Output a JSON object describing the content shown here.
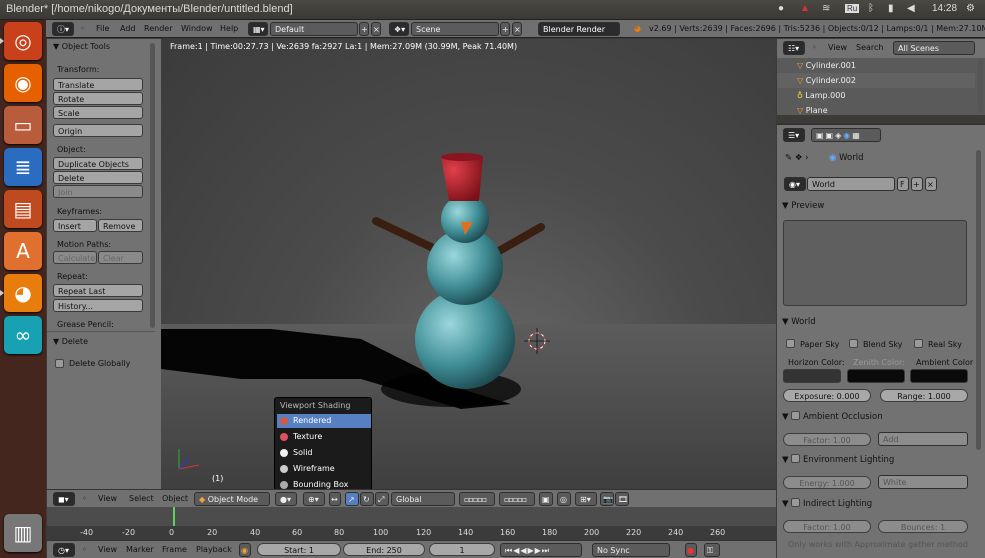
{
  "window": {
    "title": "Blender* [/home/nikogo/Документы/Blender/untitled.blend]"
  },
  "tray": {
    "kbd": "Ru",
    "time": "14:28"
  },
  "launcher": [
    "dash",
    "firefox",
    "files",
    "writer",
    "impress",
    "software",
    "blender",
    "arduino",
    "trash"
  ],
  "header": {
    "menus": [
      "File",
      "Add",
      "Render",
      "Window",
      "Help"
    ],
    "layout": "Default",
    "scene": "Scene",
    "engine": "Blender Render",
    "stats": "v2.69 | Verts:2639 | Faces:2696 | Tris:5236 | Objects:0/12 | Lamps:0/1 | Mem:27.10M (30.9"
  },
  "tools": {
    "panel_title": "Object Tools",
    "transform_label": "Transform:",
    "translate": "Translate",
    "rotate": "Rotate",
    "scale": "Scale",
    "origin": "Origin",
    "object_label": "Object:",
    "duplicate": "Duplicate Objects",
    "delete": "Delete",
    "join": "Join",
    "keyframes_label": "Keyframes:",
    "insert": "Insert",
    "remove": "Remove",
    "motion_label": "Motion Paths:",
    "calculate": "Calculate",
    "clear": "Clear",
    "repeat_label": "Repeat:",
    "repeat_last": "Repeat Last",
    "history": "History...",
    "grease_label": "Grease Pencil:",
    "delete_panel": "Delete",
    "delete_globally": "Delete Globally"
  },
  "viewport": {
    "info": "Frame:1 | Time:00:27.73 | Ve:2639 fa:2927 La:1 | Mem:27.09M (30.99M, Peak 71.40M)",
    "frame_label": "(1)"
  },
  "shading_menu": {
    "title": "Viewport Shading",
    "items": [
      {
        "label": "Rendered",
        "color": "#d05a4a"
      },
      {
        "label": "Texture",
        "color": "#e05060"
      },
      {
        "label": "Solid",
        "color": "#f0f0f0"
      },
      {
        "label": "Wireframe",
        "color": "#cccccc"
      },
      {
        "label": "Bounding Box",
        "color": "#aaaaaa"
      }
    ]
  },
  "vp_header": {
    "view": "View",
    "select": "Select",
    "object": "Object",
    "mode": "Object Mode",
    "orientation": "Global"
  },
  "timeline": {
    "ticks": [
      "-40",
      "-20",
      "0",
      "20",
      "40",
      "60",
      "80",
      "100",
      "120",
      "140",
      "160",
      "180",
      "200",
      "220",
      "240",
      "260"
    ]
  },
  "tl_header": {
    "view": "View",
    "marker": "Marker",
    "frame": "Frame",
    "playback": "Playback",
    "start": "Start: 1",
    "end": "End: 250",
    "current": "1",
    "sync": "No Sync"
  },
  "outliner": {
    "view": "View",
    "search": "Search",
    "filter": "All Scenes",
    "rows": [
      "Cylinder.001",
      "Cylinder.002",
      "Lamp.000",
      "Plane"
    ]
  },
  "props": {
    "world_crumb": "World",
    "world_name": "World",
    "preview": "Preview",
    "world": "World",
    "paper_sky": "Paper Sky",
    "blend_sky": "Blend Sky",
    "real_sky": "Real Sky",
    "horizon": "Horizon Color:",
    "zenith": "Zenith Color:",
    "ambient": "Ambient Color",
    "exposure": "Exposure: 0.000",
    "range": "Range: 1.000",
    "ao": "Ambient Occlusion",
    "ao_factor": "Factor: 1.00",
    "ao_mode": "Add",
    "env": "Environment Lighting",
    "env_energy": "Energy: 1.000",
    "env_color": "White",
    "indirect": "Indirect Lighting",
    "ind_factor": "Factor: 1.00",
    "ind_bounces": "Bounces: 1",
    "note": "Only works with Approximate gather method"
  }
}
